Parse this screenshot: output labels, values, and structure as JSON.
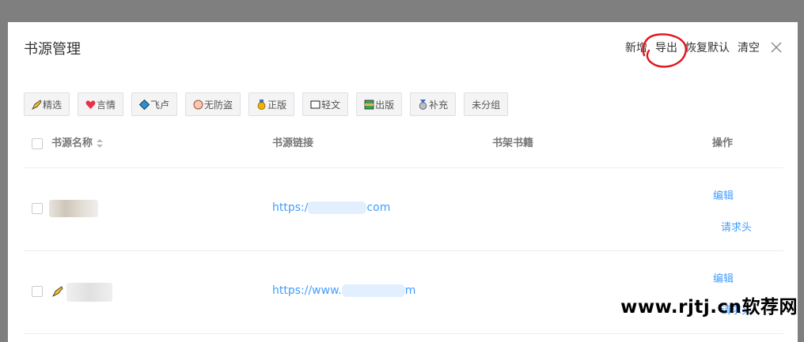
{
  "dialog": {
    "title": "书源管理",
    "actions": [
      "新增",
      "导出",
      "恢复默认",
      "清空"
    ]
  },
  "tags": [
    {
      "label": "精选",
      "icon": "pen-icon"
    },
    {
      "label": "言情",
      "icon": "heart-icon"
    },
    {
      "label": "飞卢",
      "icon": "diamond-icon"
    },
    {
      "label": "无防盗",
      "icon": "badge-icon"
    },
    {
      "label": "正版",
      "icon": "medal-icon"
    },
    {
      "label": "轻文",
      "icon": "book-icon"
    },
    {
      "label": "出版",
      "icon": "books-icon"
    },
    {
      "label": "补充",
      "icon": "ribbon-medal-icon"
    },
    {
      "label": "未分组",
      "icon": ""
    }
  ],
  "table": {
    "headers": [
      "书源名称",
      "书源链接",
      "书架书籍",
      "操作"
    ],
    "rows": [
      {
        "link_prefix": "https:/",
        "link_suffix": "com",
        "ops": [
          "编辑",
          "请求头"
        ]
      },
      {
        "link_prefix": "https://www.",
        "link_suffix": "m",
        "ops": [
          "编辑",
          "请求头"
        ]
      }
    ]
  },
  "watermark": "www.rjtj.cn软荐网",
  "colors": {
    "accent": "#409eff",
    "annotation": "#e0141e",
    "overlay": "#7f7f7f"
  }
}
